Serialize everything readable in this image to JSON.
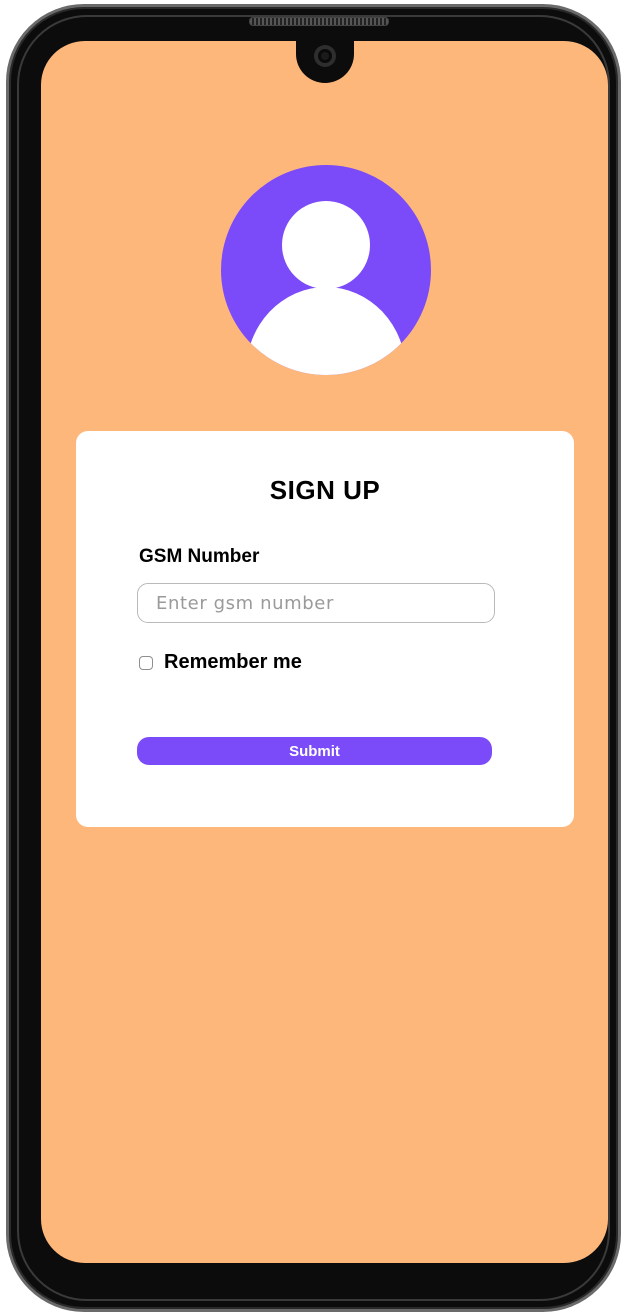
{
  "colors": {
    "screen_background": "#FDB77B",
    "accent": "#7B4BF9",
    "card_background": "#FFFFFF",
    "device_frame": "#0C0C0C"
  },
  "avatar": {
    "icon": "user-avatar-icon"
  },
  "form": {
    "title": "SIGN UP",
    "gsm_label": "GSM Number",
    "gsm_value": "",
    "gsm_placeholder": "Enter gsm number",
    "remember_label": "Remember me",
    "remember_checked": false,
    "submit_label": "Submit"
  }
}
